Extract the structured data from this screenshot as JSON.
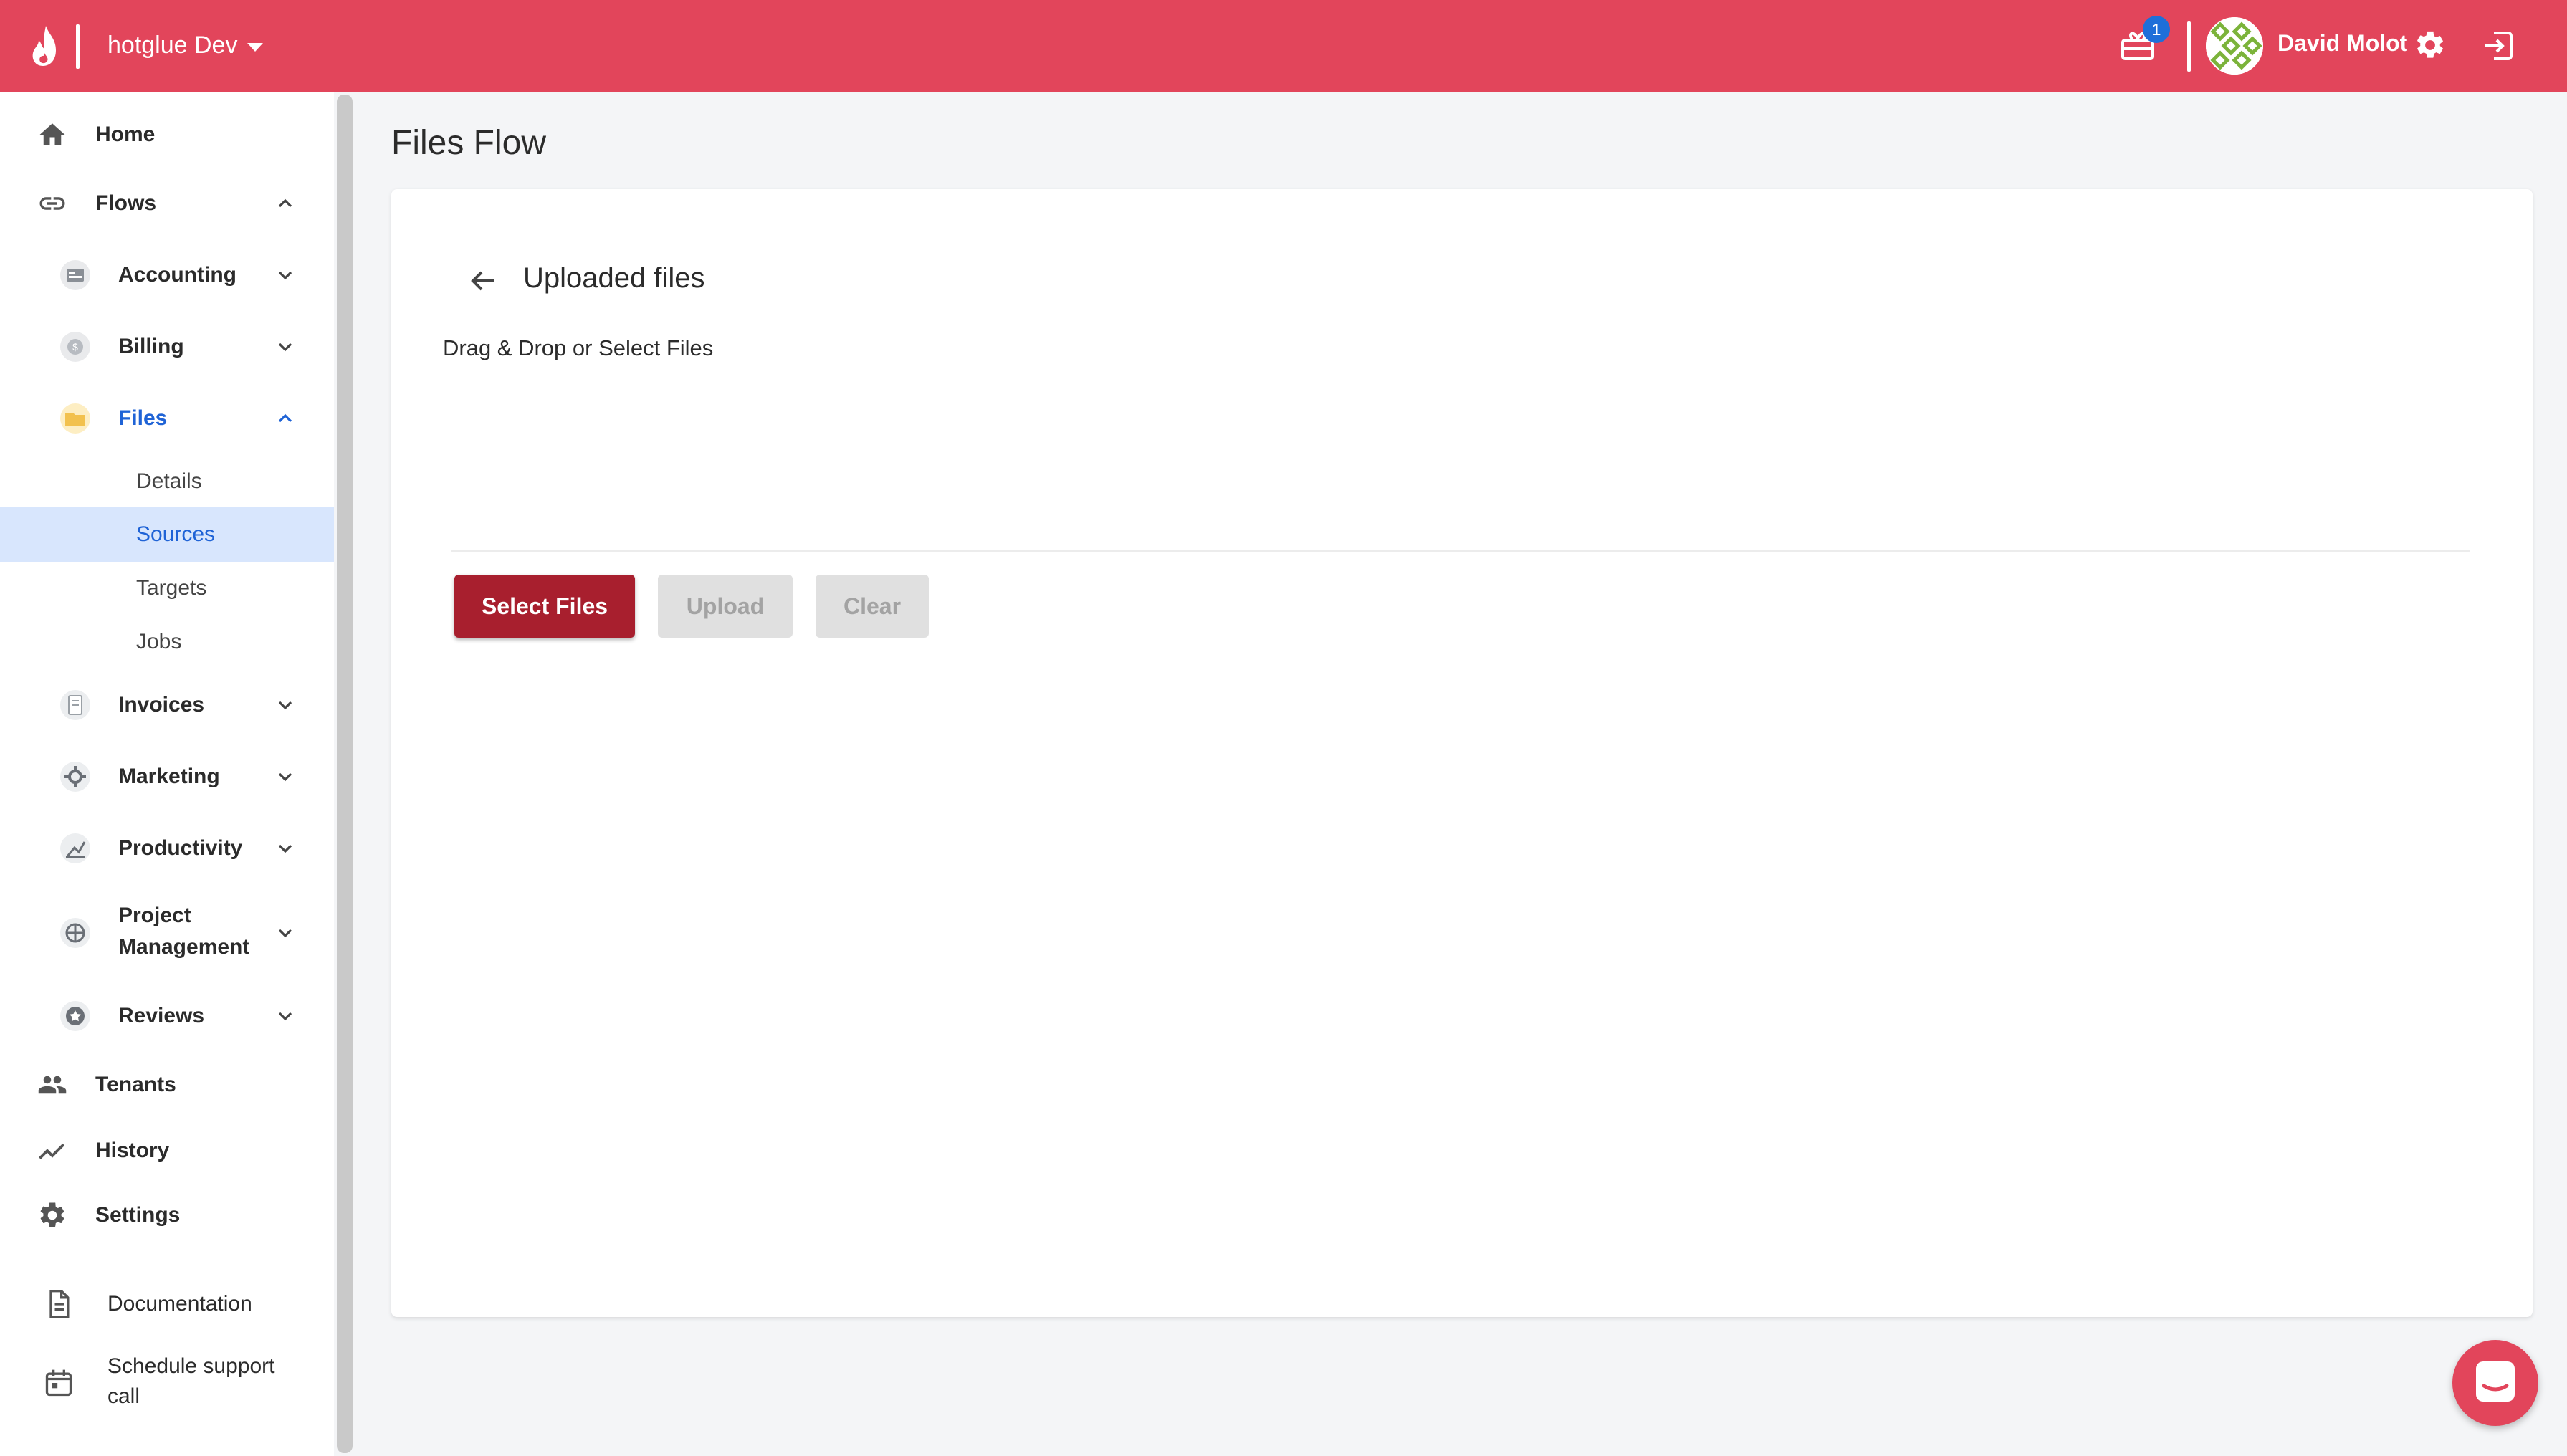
{
  "colors": {
    "brand": "#e2455b",
    "primary_button": "#a81f2e",
    "selected_bg": "#d8e6fd",
    "active_text": "#1f63d6",
    "badge": "#1e6fd9"
  },
  "topbar": {
    "env_name": "hotglue Dev",
    "notification_count": "1",
    "user_name": "David Molot",
    "icons": [
      "flame-logo-icon",
      "caret-down-icon",
      "gift-icon",
      "avatar",
      "gear-icon",
      "logout-icon"
    ]
  },
  "sidebar": {
    "home": "Home",
    "flows": "Flows",
    "accounting": "Accounting",
    "billing": "Billing",
    "files": "Files",
    "files_children": {
      "details": "Details",
      "sources": "Sources",
      "targets": "Targets",
      "jobs": "Jobs"
    },
    "invoices": "Invoices",
    "marketing": "Marketing",
    "productivity": "Productivity",
    "project_management_1": "Project",
    "project_management_2": "Management",
    "reviews": "Reviews",
    "tenants": "Tenants",
    "history": "History",
    "settings": "Settings",
    "documentation": "Documentation",
    "support_1": "Schedule support",
    "support_2": "call"
  },
  "main": {
    "page_title": "Files Flow",
    "card_title": "Uploaded files",
    "dropzone_text": "Drag & Drop or Select Files",
    "buttons": {
      "select": "Select Files",
      "upload": "Upload",
      "clear": "Clear"
    }
  }
}
